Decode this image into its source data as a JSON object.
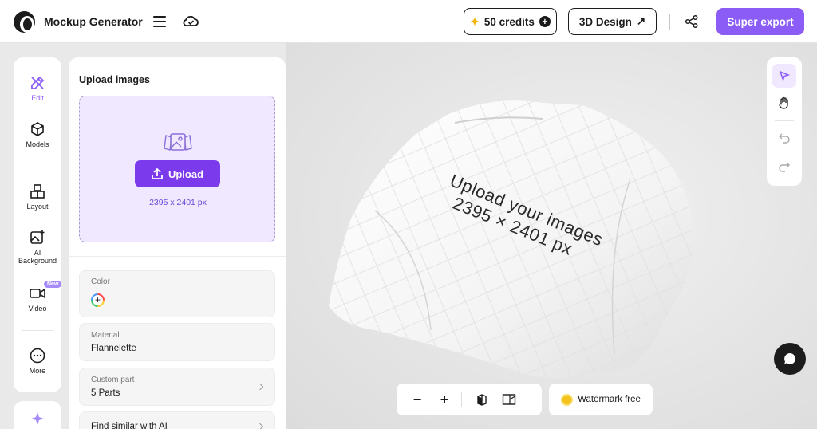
{
  "app": {
    "title": "Mockup Generator"
  },
  "header": {
    "credits_label": "50 credits",
    "design_label": "3D Design",
    "export_label": "Super export",
    "accent": "#8b5cf6"
  },
  "rail": {
    "items": [
      {
        "label": "Edit",
        "icon": "pencil-ruler-icon",
        "active": true
      },
      {
        "label": "Models",
        "icon": "cube-icon"
      },
      {
        "label": "Layout",
        "icon": "boxes-icon"
      },
      {
        "label": "AI",
        "label2": "Background",
        "icon": "ai-background-icon"
      },
      {
        "label": "Video",
        "icon": "video-icon",
        "badge": "New"
      },
      {
        "label": "More",
        "icon": "more-icon"
      }
    ]
  },
  "panel": {
    "title": "Upload images",
    "upload_label": "Upload",
    "upload_dims": "2395 x 2401 px",
    "color_label": "Color",
    "material_label": "Material",
    "material_value": "Flannelette",
    "custom_part_label": "Custom part",
    "custom_part_value": "5 Parts",
    "find_similar_label": "Find similar with AI"
  },
  "canvas": {
    "mockup_line1": "Upload your images",
    "mockup_line2": "2395 × 2401 px",
    "watermark_label": "Watermark free"
  }
}
